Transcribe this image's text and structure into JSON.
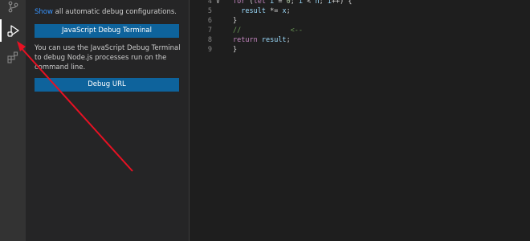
{
  "activity_bar": {
    "items": [
      {
        "icon": "source-control-icon"
      },
      {
        "icon": "run-and-debug-icon",
        "active": true
      },
      {
        "icon": "extensions-icon"
      }
    ]
  },
  "sidebar": {
    "show_link": "Show",
    "show_rest": " all automatic debug configurations.",
    "js_debug_terminal_label": "JavaScript Debug Terminal",
    "description": "You can use the JavaScript Debug Terminal to debug Node.js processes run on the command line.",
    "debug_url_label": "Debug URL"
  },
  "editor": {
    "lines": [
      {
        "num": "4",
        "fold": true,
        "parts": [
          [
            "kw",
            "for"
          ],
          [
            "txt",
            " ("
          ],
          [
            "kw",
            "let"
          ],
          [
            "txt",
            " "
          ],
          [
            "var",
            "i"
          ],
          [
            "txt",
            " = "
          ],
          [
            "num",
            "0"
          ],
          [
            "txt",
            "; "
          ],
          [
            "var",
            "i"
          ],
          [
            "txt",
            " < "
          ],
          [
            "var",
            "n"
          ],
          [
            "txt",
            "; "
          ],
          [
            "var",
            "i"
          ],
          [
            "txt",
            "++) {"
          ]
        ]
      },
      {
        "num": "5",
        "parts": [
          [
            "txt",
            "  "
          ],
          [
            "var",
            "result"
          ],
          [
            "txt",
            " *= "
          ],
          [
            "var",
            "x"
          ],
          [
            "txt",
            ";"
          ]
        ]
      },
      {
        "num": "6",
        "parts": [
          [
            "txt",
            "}"
          ]
        ]
      },
      {
        "num": "7",
        "parts": [
          [
            "cmt",
            "//            <--"
          ]
        ]
      },
      {
        "num": "8",
        "parts": [
          [
            "kw",
            "return"
          ],
          [
            "txt",
            " "
          ],
          [
            "var",
            "result"
          ],
          [
            "txt",
            ";"
          ]
        ]
      },
      {
        "num": "9",
        "parts": [
          [
            "txt",
            "}"
          ]
        ]
      }
    ]
  },
  "annotation": {
    "arrow_color": "#e81123"
  }
}
